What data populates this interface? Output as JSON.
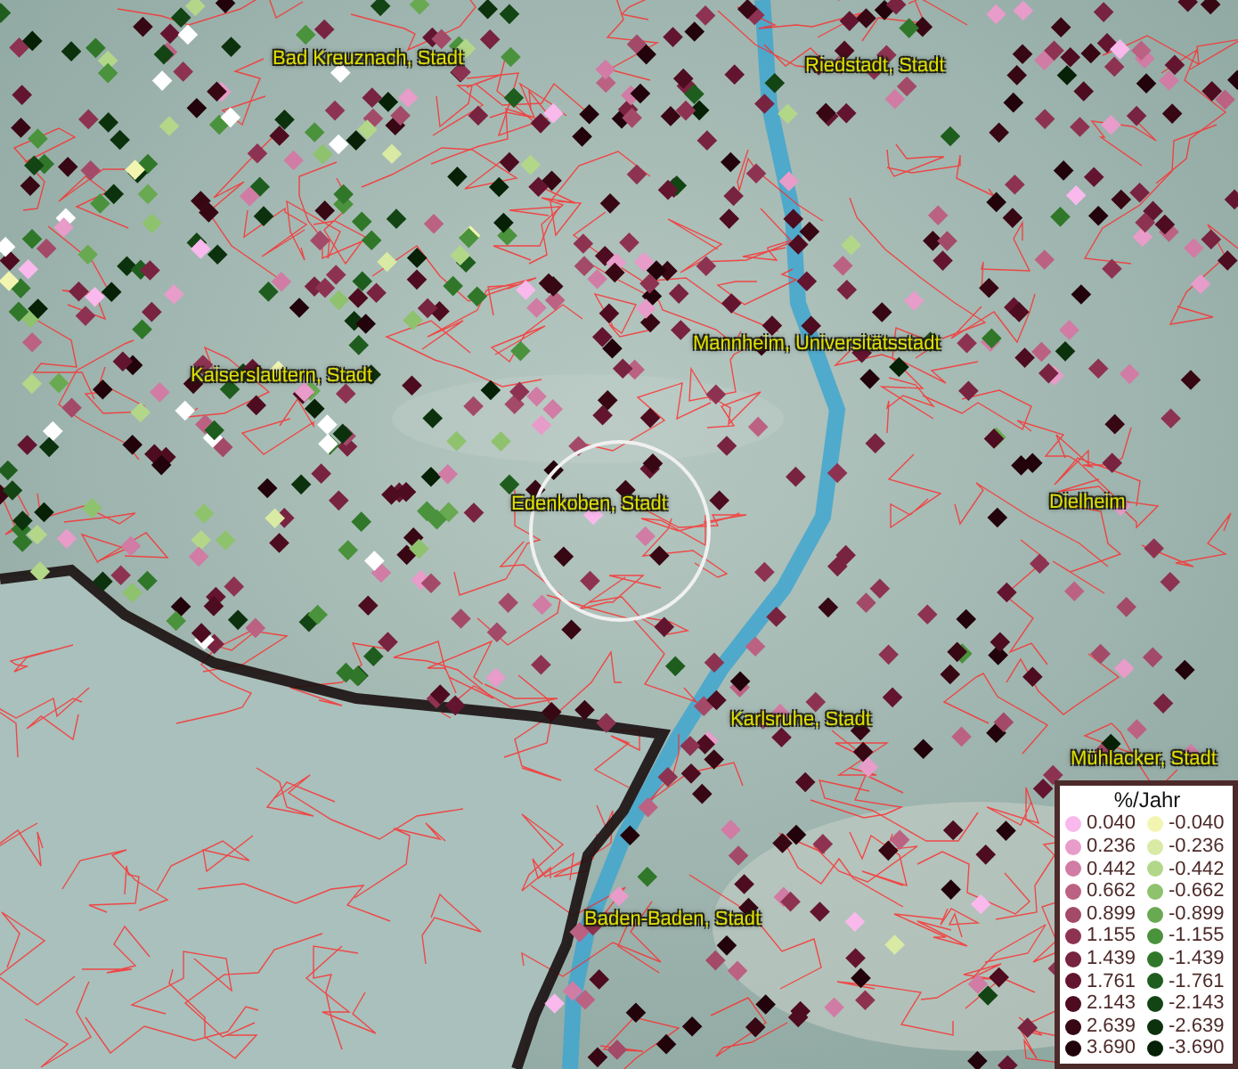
{
  "map_labels": [
    {
      "text": "Bad Kreuznach, Stadt"
    },
    {
      "text": "Riedstadt, Stadt"
    },
    {
      "text": "Kaiserslautern, Stadt"
    },
    {
      "text": "Mannheim, Universitätsstadt"
    },
    {
      "text": "Edenkoben, Stadt"
    },
    {
      "text": "Dielheim"
    },
    {
      "text": "Karlsruhe, Stadt"
    },
    {
      "text": "Mühlacker, Stadt"
    },
    {
      "text": "Baden-Baden, Stadt"
    }
  ],
  "legend": {
    "title": "%/Jahr",
    "positive": [
      {
        "label": "0.040",
        "color": "#f9b9ec"
      },
      {
        "label": "0.236",
        "color": "#e79cc9"
      },
      {
        "label": "0.442",
        "color": "#d07ca4"
      },
      {
        "label": "0.662",
        "color": "#bb6283"
      },
      {
        "label": "0.899",
        "color": "#a34a68"
      },
      {
        "label": "1.155",
        "color": "#8d3351"
      },
      {
        "label": "1.439",
        "color": "#782340"
      },
      {
        "label": "1.761",
        "color": "#631530"
      },
      {
        "label": "2.143",
        "color": "#4d0c1f"
      },
      {
        "label": "2.639",
        "color": "#380714"
      },
      {
        "label": "3.690",
        "color": "#22030b"
      }
    ],
    "negative": [
      {
        "label": "-0.040",
        "color": "#f2f5b0"
      },
      {
        "label": "-0.236",
        "color": "#d8eaa4"
      },
      {
        "label": "-0.442",
        "color": "#b3d789"
      },
      {
        "label": "-0.662",
        "color": "#8ec26d"
      },
      {
        "label": "-0.899",
        "color": "#69a951"
      },
      {
        "label": "-1.155",
        "color": "#4a923c"
      },
      {
        "label": "-1.439",
        "color": "#30772a"
      },
      {
        "label": "-1.761",
        "color": "#1e5d1e"
      },
      {
        "label": "-2.143",
        "color": "#134414"
      },
      {
        "label": "-2.639",
        "color": "#0c320d"
      },
      {
        "label": "-3.690",
        "color": "#062106"
      }
    ]
  }
}
